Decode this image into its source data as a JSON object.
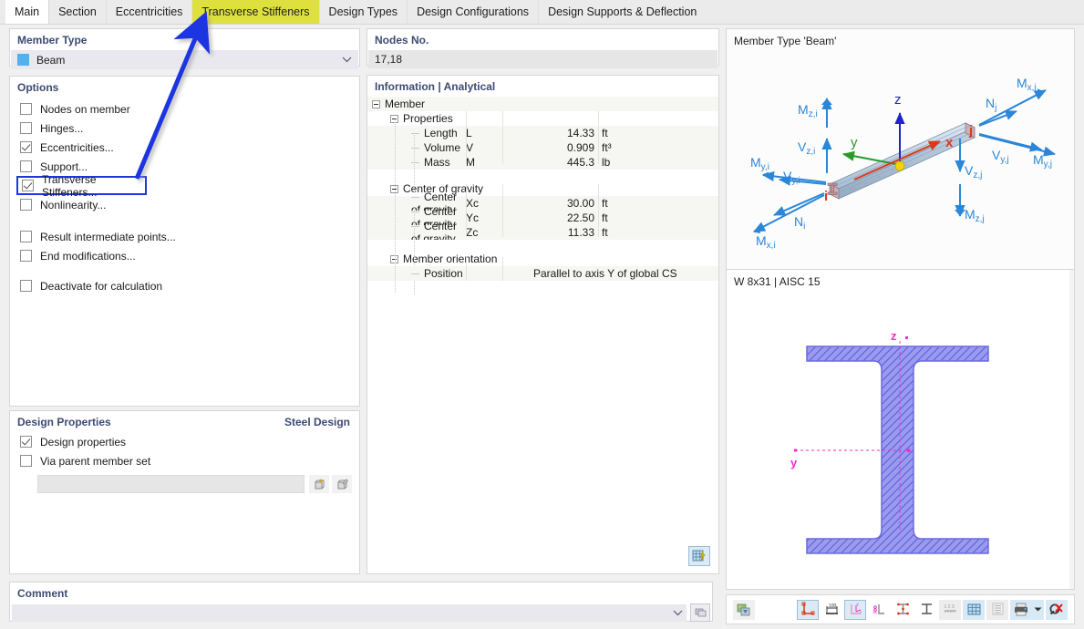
{
  "tabs": [
    {
      "label": "Main",
      "state": "selected"
    },
    {
      "label": "Section",
      "state": "normal"
    },
    {
      "label": "Eccentricities",
      "state": "normal"
    },
    {
      "label": "Transverse Stiffeners",
      "state": "highlighted"
    },
    {
      "label": "Design Types",
      "state": "normal"
    },
    {
      "label": "Design Configurations",
      "state": "normal"
    },
    {
      "label": "Design Supports & Deflection",
      "state": "normal"
    }
  ],
  "member_type": {
    "title": "Member Type",
    "value": "Beam",
    "swatch_color": "#57b0ee",
    "chevron": "⌄"
  },
  "options": {
    "title": "Options",
    "items": [
      {
        "label": "Nodes on member",
        "checked": false,
        "boxed": false
      },
      {
        "label": "Hinges...",
        "checked": false,
        "boxed": false
      },
      {
        "label": "Eccentricities...",
        "checked": true,
        "boxed": false
      },
      {
        "label": "Support...",
        "checked": false,
        "boxed": false
      },
      {
        "label": "Transverse Stiffeners...",
        "checked": true,
        "boxed": true
      },
      {
        "label": "Nonlinearity...",
        "checked": false,
        "boxed": false
      }
    ],
    "items2": [
      {
        "label": "Result intermediate points...",
        "checked": false
      },
      {
        "label": "End modifications...",
        "checked": false
      }
    ],
    "items3": [
      {
        "label": "Deactivate for calculation",
        "checked": false
      }
    ]
  },
  "design_properties": {
    "title": "Design Properties",
    "title_right": "Steel Design",
    "items": [
      {
        "label": "Design properties",
        "checked": true
      },
      {
        "label": "Via parent member set",
        "checked": false
      }
    ],
    "field_value": "",
    "buttons": [
      "new-member-set-icon",
      "edit-member-set-icon"
    ]
  },
  "comment": {
    "title": "Comment",
    "value": "",
    "chevron": "⌄",
    "button_icon": "comment-picker-icon"
  },
  "nodes": {
    "title": "Nodes No.",
    "value": "17,18"
  },
  "information": {
    "title": "Information | Analytical",
    "root": "Member",
    "groups": [
      {
        "name": "Properties",
        "rows": [
          {
            "name": "Length",
            "symbol": "L",
            "value": "14.33",
            "unit": "ft"
          },
          {
            "name": "Volume",
            "symbol": "V",
            "value": "0.909",
            "unit": "ft³"
          },
          {
            "name": "Mass",
            "symbol": "M",
            "value": "445.3",
            "unit": "lb"
          }
        ]
      },
      {
        "name": "Center of gravity",
        "rows": [
          {
            "name": "Center of gravity",
            "symbol": "Xc",
            "value": "30.00",
            "unit": "ft"
          },
          {
            "name": "Center of gravity",
            "symbol": "Yc",
            "value": "22.50",
            "unit": "ft"
          },
          {
            "name": "Center of gravity",
            "symbol": "Zc",
            "value": "11.33",
            "unit": "ft"
          }
        ]
      },
      {
        "name": "Member orientation",
        "rows": [
          {
            "name": "Position",
            "symbol": "",
            "value": "",
            "unit": "Parallel to axis Y of global CS"
          }
        ]
      }
    ],
    "footer_button": "table-settings-icon"
  },
  "preview_3d": {
    "label": "Member Type 'Beam'",
    "axes": [
      {
        "text": "z",
        "color": "#2222cc"
      },
      {
        "text": "y",
        "color": "#2a9a2a"
      },
      {
        "text": "x",
        "color": "#d93a1a"
      }
    ],
    "nodes": [
      {
        "text": "i",
        "color": "#d93a1a"
      },
      {
        "text": "j",
        "color": "#d93a1a"
      }
    ],
    "force_labels": [
      "Mₓ,ⱼ",
      "Nⱼ",
      "Vᵧ,ⱼ",
      "Mᵧ,ⱼ",
      "Vᶻ,ⱼ",
      "Mᶻ,ⱼ",
      "Mᶻ,ᵢ",
      "Vᶻ,ᵢ",
      "Mᵧ,ᵢ",
      "Vᵧ,ᵢ",
      "Nᵢ",
      "Mₓ,ᵢ"
    ],
    "arrow_color": "#2a86d8"
  },
  "preview_section": {
    "label": "W 8x31 | AISC 15",
    "axis_z": "z",
    "axis_y": "y",
    "hatch_color": "#6f6fdd",
    "axis_color": "#ee2ad1"
  },
  "bottom_toolbar": {
    "left_button": "render-mode-icon",
    "buttons": [
      {
        "name": "section-outline-icon",
        "state": "framed"
      },
      {
        "name": "dimensions-icon",
        "state": "flat"
      },
      {
        "name": "principal-axes-icon",
        "state": "framed"
      },
      {
        "name": "shear-center-icon",
        "state": "flat"
      },
      {
        "name": "stress-points-icon",
        "state": "flat"
      },
      {
        "name": "section-shape-icon",
        "state": "flat"
      },
      {
        "name": "numbering-icon",
        "state": "disabled"
      },
      {
        "name": "grid-icon",
        "state": "flat"
      },
      {
        "name": "table-list-icon",
        "state": "disabled"
      },
      {
        "name": "print-icon",
        "state": "flat"
      },
      {
        "name": "print-dropdown-icon",
        "state": "flat"
      },
      {
        "name": "clear-selection-icon",
        "state": "flat"
      }
    ]
  },
  "annotation": {
    "arrow_color": "#1f35e0",
    "highlight_color": "#dee03e"
  }
}
